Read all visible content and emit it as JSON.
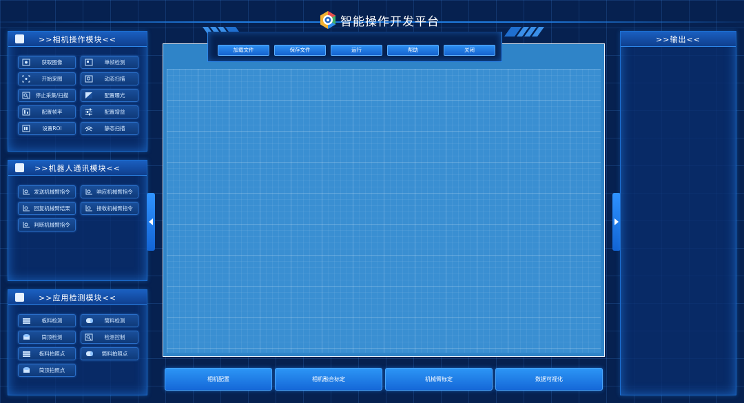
{
  "app": {
    "title": "智能操作开发平台"
  },
  "camera_panel": {
    "title": ">>相机操作模块<<",
    "buttons": [
      {
        "label": "获取图像",
        "icon": "camera-capture-icon"
      },
      {
        "label": "单帧检测",
        "icon": "single-frame-icon"
      },
      {
        "label": "开始采图",
        "icon": "focus-start-icon"
      },
      {
        "label": "动态扫描",
        "icon": "dynamic-scan-icon"
      },
      {
        "label": "停止采集/扫描",
        "icon": "stop-scan-icon"
      },
      {
        "label": "配置曝光",
        "icon": "exposure-icon"
      },
      {
        "label": "配置帧率",
        "icon": "framerate-icon"
      },
      {
        "label": "配置增益",
        "icon": "gain-sliders-icon"
      },
      {
        "label": "设置ROI",
        "icon": "roi-icon"
      },
      {
        "label": "静态扫描",
        "icon": "static-scan-icon"
      }
    ]
  },
  "robot_panel": {
    "title": ">>机器人通讯模块<<",
    "buttons": [
      {
        "label": "发送机械臂指令",
        "icon": "robot-command-icon"
      },
      {
        "label": "响应机械臂指令",
        "icon": "robot-command-icon"
      },
      {
        "label": "回复机械臂结果",
        "icon": "robot-command-icon"
      },
      {
        "label": "接收机械臂指令",
        "icon": "robot-command-icon"
      },
      {
        "label": "判断机械臂指令",
        "icon": "robot-command-icon"
      }
    ]
  },
  "detect_panel": {
    "title": ">>应用检测模块<<",
    "buttons": [
      {
        "label": "板料检测",
        "icon": "board-material-icon"
      },
      {
        "label": "筒料检测",
        "icon": "cylinder-material-icon"
      },
      {
        "label": "筒顶检测",
        "icon": "cylinder-top-icon"
      },
      {
        "label": "检测控制",
        "icon": "detect-control-icon"
      },
      {
        "label": "板料拍照点",
        "icon": "board-material-icon"
      },
      {
        "label": "筒料拍照点",
        "icon": "cylinder-material-icon"
      },
      {
        "label": "筒顶拍照点",
        "icon": "cylinder-top-icon"
      }
    ]
  },
  "toolbar": {
    "buttons": [
      "加载文件",
      "保存文件",
      "运行",
      "帮助",
      "关闭"
    ]
  },
  "output_panel": {
    "title": ">>输出<<"
  },
  "bottom_bar": {
    "buttons": [
      "相机配置",
      "相机融合标定",
      "机械臂标定",
      "数据可视化"
    ]
  },
  "colors": {
    "background": "#062150",
    "accent": "#1f7be0",
    "canvas": "#3a8fd2"
  }
}
